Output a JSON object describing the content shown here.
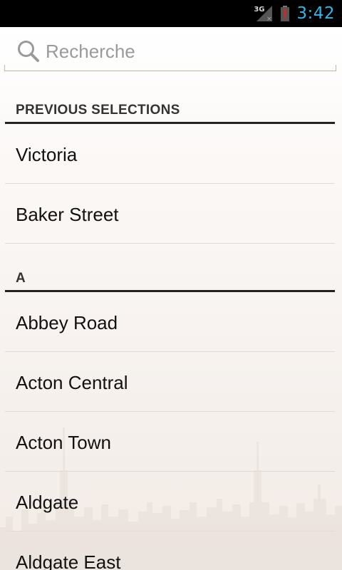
{
  "status_bar": {
    "network_label": "3G",
    "time": "3:42",
    "accent_color": "#33b5e5"
  },
  "search": {
    "placeholder": "Recherche",
    "value": "",
    "icon": "search-icon"
  },
  "sections": {
    "previous": {
      "title": "PREVIOUS SELECTIONS",
      "items": [
        "Victoria",
        "Baker Street"
      ]
    },
    "a": {
      "title": "A",
      "items": [
        "Abbey Road",
        "Acton Central",
        "Acton Town",
        "Aldgate",
        "Aldgate East"
      ]
    }
  }
}
